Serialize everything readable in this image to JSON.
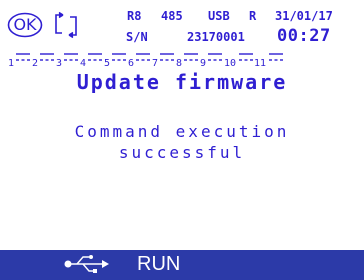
{
  "colors": {
    "text": "#2f1fd2",
    "bottom_bar": "#2c3aa8",
    "bottom_text": "#ffffff",
    "background": "#ffffff"
  },
  "status": {
    "ok_text": "OK",
    "ok_icon": "ok-oval-icon",
    "sync_icon": "sync-arrows-icon",
    "relay": "R8",
    "protocol": "485",
    "interface": "USB",
    "mode": "R",
    "date": "31/01/17",
    "serial_label": "S/N",
    "serial_number": "23170001",
    "time": "00:27"
  },
  "channels": [
    {
      "number": "1"
    },
    {
      "number": "2"
    },
    {
      "number": "3"
    },
    {
      "number": "4"
    },
    {
      "number": "5"
    },
    {
      "number": "6"
    },
    {
      "number": "7"
    },
    {
      "number": "8"
    },
    {
      "number": "9"
    },
    {
      "number": "10"
    },
    {
      "number": "11"
    }
  ],
  "channel_icon": "dc-symbol-icon",
  "screen": {
    "title": "Update firmware",
    "message_line1": "Command execution",
    "message_line2": "successful"
  },
  "bottom_bar": {
    "usb_icon": "usb-icon",
    "state": "RUN"
  }
}
